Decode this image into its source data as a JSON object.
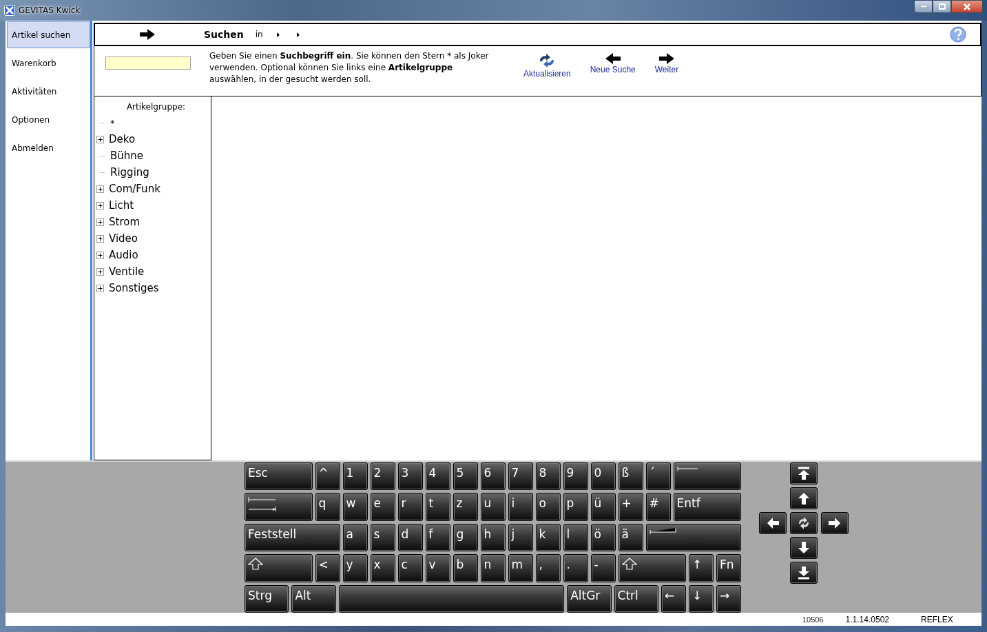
{
  "window": {
    "title": "GEVITAS Kwick"
  },
  "sidebar": {
    "items": [
      {
        "label": "Artikel suchen",
        "selected": true
      },
      {
        "label": "Warenkorb",
        "selected": false
      },
      {
        "label": "Aktivitäten",
        "selected": false
      },
      {
        "label": "Optionen",
        "selected": false
      },
      {
        "label": "Abmelden",
        "selected": false
      }
    ]
  },
  "header": {
    "title": "Suchen",
    "in_label": "in"
  },
  "search": {
    "hint": "Geben Sie einen **Suchbegriff ein**. Sie können den Stern * als Joker verwenden. Optional können Sie links eine **Artikelgruppe** auswählen, in der gesucht werden soll."
  },
  "actions": [
    {
      "label": "Aktualisieren",
      "kind": "refresh"
    },
    {
      "label": "Neue Suche",
      "kind": "back"
    },
    {
      "label": "Weiter",
      "kind": "forward"
    }
  ],
  "tree": {
    "title": "Artikelgruppe:",
    "items": [
      {
        "label": "*",
        "kind": "leaf"
      },
      {
        "label": "Deko",
        "kind": "group"
      },
      {
        "label": "Bühne",
        "kind": "leaf"
      },
      {
        "label": "Rigging",
        "kind": "leaf"
      },
      {
        "label": "Com/Funk",
        "kind": "group"
      },
      {
        "label": "Licht",
        "kind": "group"
      },
      {
        "label": "Strom",
        "kind": "group"
      },
      {
        "label": "Video",
        "kind": "group"
      },
      {
        "label": "Audio",
        "kind": "group"
      },
      {
        "label": "Ventile",
        "kind": "group"
      },
      {
        "label": "Sonstiges",
        "kind": "group"
      }
    ]
  },
  "keyboard": {
    "rows": [
      {
        "keys": [
          {
            "label": "Esc",
            "kind": "mod"
          },
          {
            "label": "^",
            "kind": "key"
          },
          {
            "label": "1",
            "kind": "key"
          },
          {
            "label": "2",
            "kind": "key"
          },
          {
            "label": "3",
            "kind": "key"
          },
          {
            "label": "4",
            "kind": "key"
          },
          {
            "label": "5",
            "kind": "key"
          },
          {
            "label": "6",
            "kind": "key"
          },
          {
            "label": "7",
            "kind": "key"
          },
          {
            "label": "8",
            "kind": "key"
          },
          {
            "label": "9",
            "kind": "key"
          },
          {
            "label": "0",
            "kind": "key"
          },
          {
            "label": "ß",
            "kind": "key"
          },
          {
            "label": "´",
            "kind": "key"
          },
          {
            "kind": "backspace"
          }
        ]
      },
      {
        "keys": [
          {
            "kind": "tab"
          },
          {
            "label": "q",
            "kind": "key"
          },
          {
            "label": "w",
            "kind": "key"
          },
          {
            "label": "e",
            "kind": "key"
          },
          {
            "label": "r",
            "kind": "key"
          },
          {
            "label": "t",
            "kind": "key"
          },
          {
            "label": "z",
            "kind": "key"
          },
          {
            "label": "u",
            "kind": "key"
          },
          {
            "label": "i",
            "kind": "key"
          },
          {
            "label": "o",
            "kind": "key"
          },
          {
            "label": "p",
            "kind": "key"
          },
          {
            "label": "ü",
            "kind": "key"
          },
          {
            "label": "+",
            "kind": "key"
          },
          {
            "label": "#",
            "kind": "key"
          },
          {
            "label": "Entf",
            "kind": "mod"
          }
        ]
      },
      {
        "keys": [
          {
            "label": "Feststell",
            "kind": "mod"
          },
          {
            "label": "a",
            "kind": "key"
          },
          {
            "label": "s",
            "kind": "key"
          },
          {
            "label": "d",
            "kind": "key"
          },
          {
            "label": "f",
            "kind": "key"
          },
          {
            "label": "g",
            "kind": "key"
          },
          {
            "label": "h",
            "kind": "key"
          },
          {
            "label": "j",
            "kind": "key"
          },
          {
            "label": "k",
            "kind": "key"
          },
          {
            "label": "l",
            "kind": "key"
          },
          {
            "label": "ö",
            "kind": "key"
          },
          {
            "label": "ä",
            "kind": "key"
          },
          {
            "kind": "enter"
          }
        ]
      },
      {
        "keys": [
          {
            "kind": "shift"
          },
          {
            "label": "<",
            "kind": "key"
          },
          {
            "label": "y",
            "kind": "key"
          },
          {
            "label": "x",
            "kind": "key"
          },
          {
            "label": "c",
            "kind": "key"
          },
          {
            "label": "v",
            "kind": "key"
          },
          {
            "label": "b",
            "kind": "key"
          },
          {
            "label": "n",
            "kind": "key"
          },
          {
            "label": "m",
            "kind": "key"
          },
          {
            "label": ",",
            "kind": "key"
          },
          {
            "label": ".",
            "kind": "key"
          },
          {
            "label": "-",
            "kind": "key"
          },
          {
            "kind": "shift"
          },
          {
            "label": "↑",
            "kind": "key"
          },
          {
            "label": "Fn",
            "kind": "key"
          }
        ]
      },
      {
        "keys": [
          {
            "label": "Strg",
            "kind": "mod"
          },
          {
            "label": "Alt",
            "kind": "mod"
          },
          {
            "kind": "space"
          },
          {
            "label": "AltGr",
            "kind": "mod"
          },
          {
            "label": "Ctrl",
            "kind": "mod"
          },
          {
            "label": "←",
            "kind": "key"
          },
          {
            "label": "↓",
            "kind": "key"
          },
          {
            "label": "→",
            "kind": "key"
          }
        ]
      }
    ]
  },
  "status_bar": {
    "items": [
      "10506",
      "1.1.14.0502",
      "REFLEX"
    ]
  }
}
